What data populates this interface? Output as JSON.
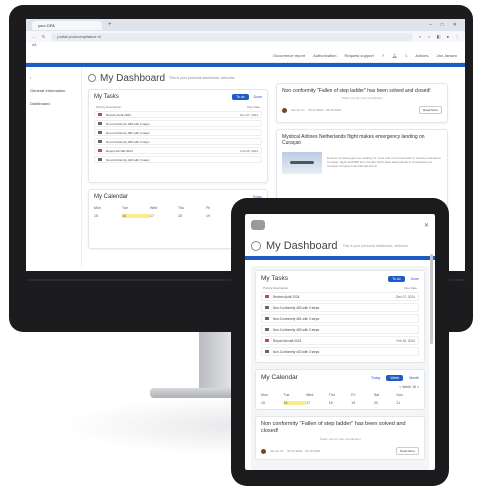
{
  "browser": {
    "tab_title": "your DPA",
    "url": "portal.yourcompliance.nl",
    "bookmark_text": "All"
  },
  "header": {
    "links": [
      "Occurrence report",
      "Authorization",
      "Request support"
    ],
    "notif_count": "1",
    "actions_label": "Actions",
    "user_label": "Jan Jansen"
  },
  "sidebar": {
    "items": [
      "",
      "General Information",
      "Dashboard"
    ]
  },
  "dashboard": {
    "title": "My Dashboard",
    "subtitle": "This is your personal dashboard, welcome"
  },
  "tasks": {
    "title": "My Tasks",
    "todo_label": "To do",
    "done_label": "Done",
    "col_subject": "Priority   Description",
    "col_due": "Due Date",
    "rows": [
      {
        "text": "Review   Audit 2024",
        "due": "Dec 07, 2024",
        "icon": "red"
      },
      {
        "text": "Non-Conformity 483 with 3 steps",
        "due": "",
        "icon": "grey"
      },
      {
        "text": "Non-Conformity 481 with 3 steps",
        "due": "",
        "icon": "grey"
      },
      {
        "text": "Non-Conformity 483 with 3 steps",
        "due": "",
        "icon": "grey"
      },
      {
        "text": "Report   Aircraft 2024",
        "due": "Feb 26, 2024",
        "icon": "red"
      },
      {
        "text": "Non-Conformity 443 with 3 steps",
        "due": "",
        "icon": "grey"
      }
    ]
  },
  "calendar": {
    "title": "My Calendar",
    "today_label": "Today",
    "days": [
      "Mon",
      "Tue",
      "Wed",
      "Thu",
      "Fri",
      "Sat"
    ],
    "dates": [
      "15",
      "16",
      "17",
      "18",
      "19",
      "20"
    ]
  },
  "news": [
    {
      "title": "Non conformity \"Fallen of step ladder\" has been solved and closed!",
      "subtitle": "Thank you for your contribution",
      "author": "Jan de Vri",
      "date": "05.01.2024 - 06.13.2024",
      "read_more": "Read More"
    },
    {
      "title": "Mystical Airlines Netherlands flight makes emergency landing on Curaçao",
      "text": "Dozens of passengers are waiting for news and some hundreds of tourists stranded in Curaçao, flight 4AJ/4M5 from Florida North East Netherlands to Amsterdam via Curaçao Curaçao International Airport"
    }
  ],
  "tablet": {
    "title": "My Dashboard",
    "subtitle": "This is your personal dashboard, welcome",
    "tasks_title": "My Tasks",
    "todo_label": "To do",
    "done_label": "Done",
    "col_subject": "Priority   Description",
    "col_due": "Due Date",
    "rows": [
      {
        "text": "Review   Audit 2024",
        "due": "Dec 07, 2024",
        "icon": "red"
      },
      {
        "text": "Non-Conformity 483 with 3 steps",
        "due": "",
        "icon": "grey"
      },
      {
        "text": "Non-Conformity 481 with 3 steps",
        "due": "",
        "icon": "grey"
      },
      {
        "text": "Non-Conformity 483 with 3 steps",
        "due": "",
        "icon": "grey"
      },
      {
        "text": "Report   Aircraft 2024",
        "due": "Feb 26, 2024",
        "icon": "red"
      },
      {
        "text": "Non-Conformity 443 with 3 steps",
        "due": "",
        "icon": "grey"
      }
    ],
    "calendar_title": "My Calendar",
    "cal_tabs": [
      "Today",
      "Week",
      "Month"
    ],
    "week_range": "< Week 15 >",
    "days": [
      "Mon",
      "Tue",
      "Wed",
      "Thu",
      "Fri",
      "Sat",
      "Sun"
    ],
    "dates": [
      "15",
      "16",
      "17",
      "18",
      "19",
      "20",
      "21"
    ],
    "news_title": "Non conformity \"Fallen of step ladder\" has been solved and closed!",
    "news_sub": "Thank you for your contribution",
    "news_author": "Jan de Vri",
    "news_date": "05.01.2024 - 06.13.2024",
    "read_more": "Read More"
  },
  "colors": {
    "accent": "#1e5bc6",
    "device_frame": "#1c1c1e",
    "today_highlight": "#f7f08a"
  }
}
